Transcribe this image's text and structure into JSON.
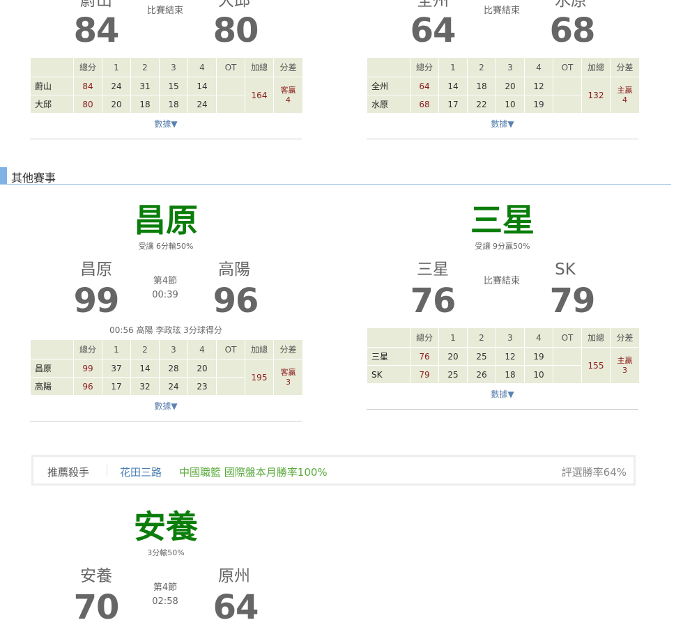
{
  "games_top": [
    {
      "home_team": "蔚山",
      "away_team": "大邱",
      "home_score": "84",
      "away_score": "80",
      "status": "比賽結束",
      "table": {
        "headers": [
          "",
          "總分",
          "1",
          "2",
          "3",
          "4",
          "OT",
          "加總",
          "分差"
        ],
        "rows": [
          {
            "team": "蔚山",
            "total": "84",
            "q": [
              "24",
              "31",
              "15",
              "14"
            ],
            "ot": ""
          },
          {
            "team": "大邱",
            "total": "80",
            "q": [
              "20",
              "18",
              "18",
              "24"
            ],
            "ot": ""
          }
        ],
        "sum": "164",
        "diff_label": "客贏",
        "diff_value": "4"
      },
      "data_link": "數據▼"
    },
    {
      "home_team": "全州",
      "away_team": "水原",
      "home_score": "64",
      "away_score": "68",
      "status": "比賽結束",
      "table": {
        "headers": [
          "",
          "總分",
          "1",
          "2",
          "3",
          "4",
          "OT",
          "加總",
          "分差"
        ],
        "rows": [
          {
            "team": "全州",
            "total": "64",
            "q": [
              "14",
              "18",
              "20",
              "12"
            ],
            "ot": ""
          },
          {
            "team": "水原",
            "total": "68",
            "q": [
              "17",
              "22",
              "10",
              "19"
            ],
            "ot": ""
          }
        ],
        "sum": "132",
        "diff_label": "主贏",
        "diff_value": "4"
      },
      "data_link": "數據▼"
    }
  ],
  "section_title": "其他賽事",
  "games_mid": [
    {
      "pick": "昌原",
      "tip": "受讓 6分輸50%",
      "home_team": "昌原",
      "away_team": "高陽",
      "home_score": "99",
      "away_score": "96",
      "status_line1": "第4節",
      "status_line2": "00:39",
      "event": "00:56 高陽 李政玹 3分球得分",
      "table": {
        "headers": [
          "",
          "總分",
          "1",
          "2",
          "3",
          "4",
          "OT",
          "加總",
          "分差"
        ],
        "rows": [
          {
            "team": "昌原",
            "total": "99",
            "q": [
              "37",
              "14",
              "28",
              "20"
            ],
            "ot": ""
          },
          {
            "team": "高陽",
            "total": "96",
            "q": [
              "17",
              "32",
              "24",
              "23"
            ],
            "ot": ""
          }
        ],
        "sum": "195",
        "diff_label": "客贏",
        "diff_value": "3"
      },
      "data_link": "數據▼"
    },
    {
      "pick": "三星",
      "tip": "受讓 9分贏50%",
      "home_team": "三星",
      "away_team": "SK",
      "home_score": "76",
      "away_score": "79",
      "status_line1": "比賽結束",
      "table": {
        "headers": [
          "",
          "總分",
          "1",
          "2",
          "3",
          "4",
          "OT",
          "加總",
          "分差"
        ],
        "rows": [
          {
            "team": "三星",
            "total": "76",
            "q": [
              "20",
              "25",
              "12",
              "19"
            ],
            "ot": ""
          },
          {
            "team": "SK",
            "total": "79",
            "q": [
              "25",
              "26",
              "18",
              "10"
            ],
            "ot": ""
          }
        ],
        "sum": "155",
        "diff_label": "主贏",
        "diff_value": "3"
      },
      "data_link": "數據▼"
    }
  ],
  "recommend": {
    "label": "推薦殺手",
    "user": "花田三路",
    "desc": "中國職籃 國際盤本月勝率100%",
    "rate": "評選勝率64%"
  },
  "game_bottom": {
    "pick": "安養",
    "tip": "3分輸50%",
    "home_team": "安養",
    "away_team": "原州",
    "home_score": "70",
    "away_score": "64",
    "status_line1": "第4節",
    "status_line2": "02:58"
  },
  "colors": {
    "pick_green": "#0a7d0a",
    "score_gray": "#666666",
    "table_bg": "#e8ebd8",
    "accent_red": "#8b1a1a",
    "link_blue": "#5a82b0",
    "section_blue": "#7fb2e5"
  }
}
